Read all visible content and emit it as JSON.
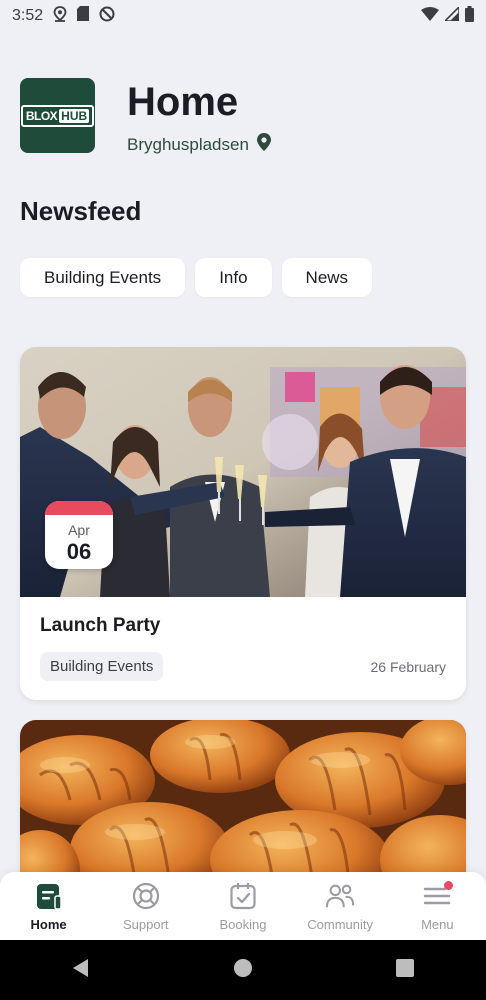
{
  "status_bar": {
    "time": "3:52",
    "left_icons": [
      "location-pin-icon",
      "sd-card-icon",
      "no-sync-icon"
    ],
    "right_icons": [
      "wifi-icon",
      "signal-icon",
      "battery-icon"
    ]
  },
  "header": {
    "logo_text_a": "BLOX",
    "logo_text_b": "HUB",
    "title": "Home",
    "location": "Bryghuspladsen",
    "location_icon": "map-pin-icon"
  },
  "newsfeed": {
    "title": "Newsfeed",
    "filters": [
      {
        "label": "Building Events"
      },
      {
        "label": "Info"
      },
      {
        "label": "News"
      }
    ]
  },
  "cards": [
    {
      "image": "party-photo",
      "date_month": "Apr",
      "date_day": "06",
      "title": "Launch Party",
      "tag": "Building Events",
      "posted": "26 February"
    },
    {
      "image": "croissants-photo"
    }
  ],
  "bottom_nav": {
    "items": [
      {
        "label": "Home",
        "icon": "home-document-icon",
        "active": true
      },
      {
        "label": "Support",
        "icon": "lifebuoy-icon",
        "active": false
      },
      {
        "label": "Booking",
        "icon": "calendar-check-icon",
        "active": false
      },
      {
        "label": "Community",
        "icon": "people-icon",
        "active": false
      },
      {
        "label": "Menu",
        "icon": "menu-icon",
        "active": false,
        "notification": true
      }
    ]
  },
  "system_nav": [
    "back-icon",
    "home-circle-icon",
    "recents-icon"
  ],
  "colors": {
    "background": "#eef0f5",
    "brand_green": "#1f4b3a",
    "accent_red": "#e84a5f",
    "text_dark": "#1a1d24",
    "nav_inactive": "#9a9ca3"
  }
}
